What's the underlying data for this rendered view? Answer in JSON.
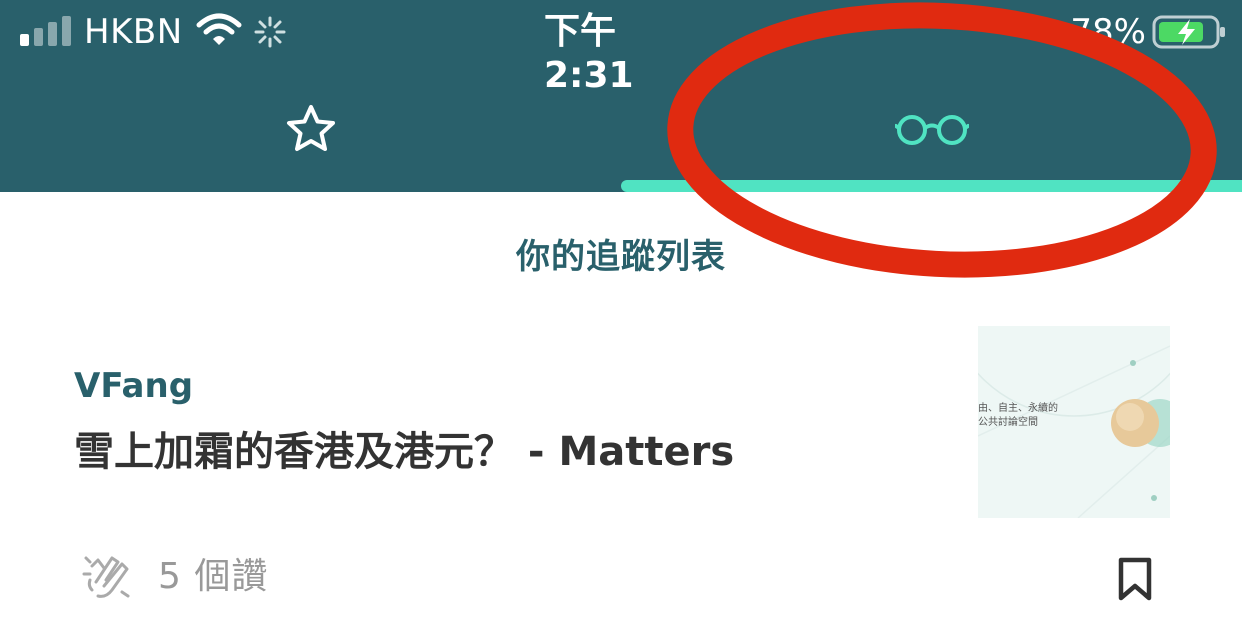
{
  "status_bar": {
    "carrier": "HKBN",
    "time": "下午 2:31",
    "battery_percent": "78%"
  },
  "tabs": [
    {
      "icon": "star-icon",
      "active": false
    },
    {
      "icon": "glasses-icon",
      "active": true
    }
  ],
  "section_title": "你的追蹤列表",
  "article": {
    "author": "VFang",
    "title": "雪上加霜的香港及港元？ - Matters",
    "thumbnail_text": [
      "由、自主、永續的",
      "公共討論空間"
    ],
    "clap_count": "5 個讚"
  },
  "colors": {
    "header_bg": "#29606b",
    "accent": "#50e3c2",
    "author": "#29606b",
    "annotation": "#e02a10"
  }
}
